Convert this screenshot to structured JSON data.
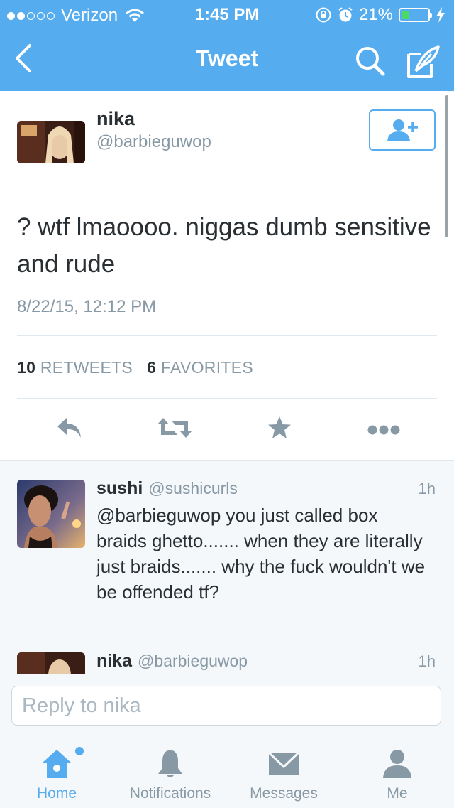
{
  "status_bar": {
    "carrier": "Verizon",
    "time": "1:45 PM",
    "battery_percent": "21%",
    "signal_bars_filled": 2,
    "signal_bars_total": 5
  },
  "nav": {
    "title": "Tweet",
    "back_icon": "chevron-left-icon",
    "search_icon": "search-icon",
    "compose_icon": "compose-icon"
  },
  "tweet": {
    "author_name": "nika",
    "author_handle": "@barbieguwop",
    "text": "? wtf lmaoooo. niggas dumb sensitive and rude",
    "date": "8/22/15, 12:12 PM",
    "retweets_count": "10",
    "retweets_label": "RETWEETS",
    "favorites_count": "6",
    "favorites_label": "FAVORITES",
    "follow_icon": "add-user-icon"
  },
  "replies": [
    {
      "name": "sushi",
      "handle": "@sushicurls",
      "time": "1h",
      "text": "@barbieguwop you just called box braids ghetto....... when they are literally just braids....... why the fuck wouldn't we be offended tf?"
    },
    {
      "name": "nika",
      "handle": "@barbieguwop",
      "time": "1h",
      "text": ""
    }
  ],
  "reply_bar": {
    "placeholder": "Reply to nika",
    "value": ""
  },
  "tabs": [
    {
      "label": "Home",
      "icon": "home-icon",
      "active": true
    },
    {
      "label": "Notifications",
      "icon": "bell-icon",
      "active": false
    },
    {
      "label": "Messages",
      "icon": "envelope-icon",
      "active": false
    },
    {
      "label": "Me",
      "icon": "person-icon",
      "active": false
    }
  ],
  "colors": {
    "brand_blue": "#55acee",
    "text_dark": "#292f33",
    "text_gray": "#8899a6",
    "action_gray": "#8899a6",
    "divider": "#e1e8ed",
    "panel_bg": "#f5f8fa"
  }
}
